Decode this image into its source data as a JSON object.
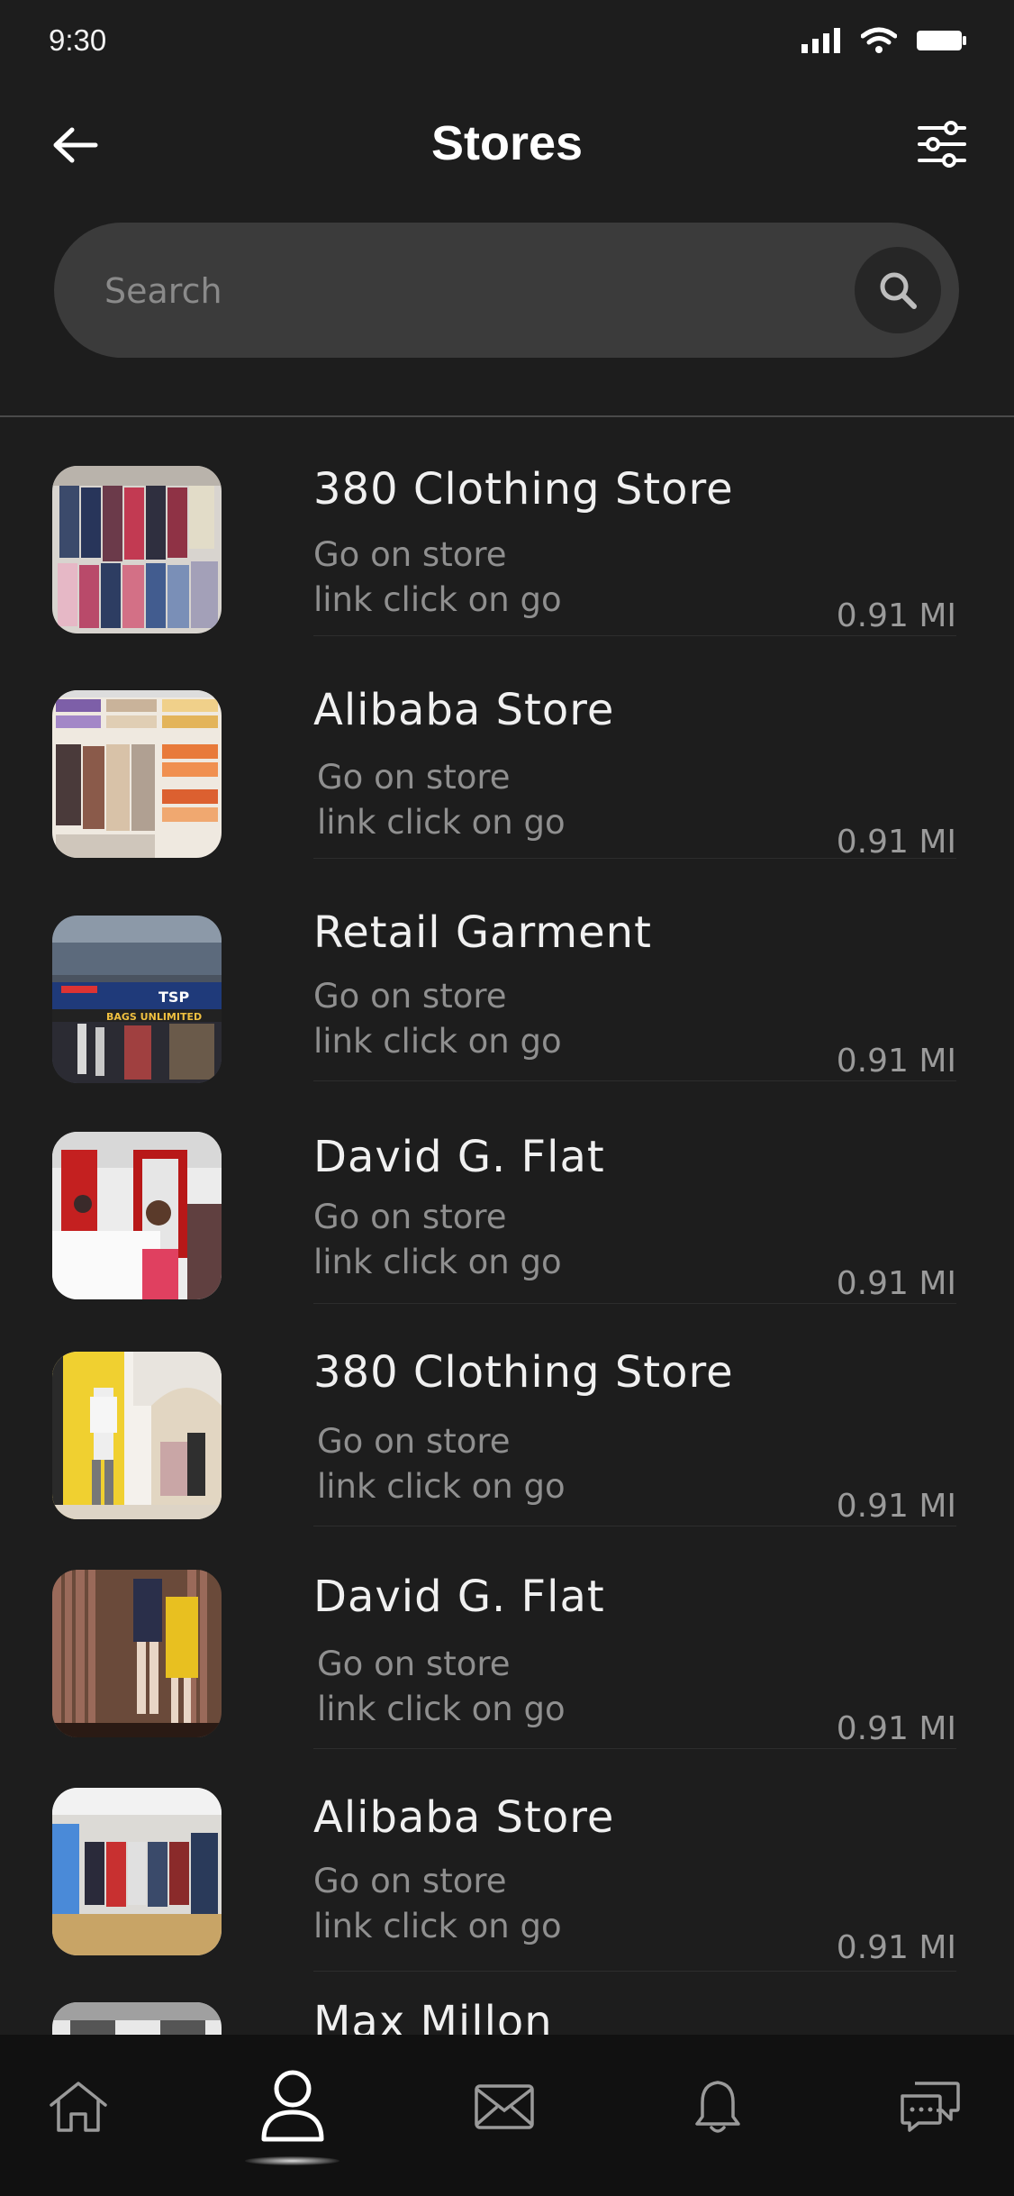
{
  "status_bar": {
    "time": "9:30",
    "icons": [
      "cellular-signal-icon",
      "wifi-icon",
      "battery-icon"
    ]
  },
  "header": {
    "title": "Stores",
    "back_icon": "arrow-left-icon",
    "filter_icon": "sliders-icon"
  },
  "search": {
    "placeholder": "Search",
    "value": "",
    "icon": "search-icon"
  },
  "stores": [
    {
      "name": "380 Clothing Store",
      "desc_line1": "Go on store",
      "desc_line2": "link click on go",
      "distance": "0.91 MI"
    },
    {
      "name": "Alibaba Store",
      "desc_line1": "Go on store",
      "desc_line2": "link click on go",
      "distance": "0.91 MI"
    },
    {
      "name": "Retail Garment",
      "desc_line1": "Go on store",
      "desc_line2": "link click on go",
      "distance": "0.91 MI"
    },
    {
      "name": "David G. Flat",
      "desc_line1": "Go on store",
      "desc_line2": "link click on go",
      "distance": "0.91 MI"
    },
    {
      "name": "380 Clothing Store",
      "desc_line1": "Go on store",
      "desc_line2": "link click on go",
      "distance": "0.91 MI"
    },
    {
      "name": "David G. Flat",
      "desc_line1": "Go on store",
      "desc_line2": "link click on go",
      "distance": "0.91 MI"
    },
    {
      "name": "Alibaba Store",
      "desc_line1": "Go on store",
      "desc_line2": "link click on go",
      "distance": "0.91 MI"
    },
    {
      "name": "Max Millon"
    }
  ],
  "store_thumb_signage": {
    "line1": "TSP",
    "line2": "BAGS UNLIMITED"
  },
  "bottom_nav": {
    "items": [
      "home-icon",
      "profile-icon",
      "mail-icon",
      "bell-icon",
      "chat-icon"
    ],
    "active": "profile-icon"
  },
  "colors": {
    "background": "#1d1d1d",
    "search_bg": "#3b3b3b",
    "nav_bg": "#111111",
    "text_primary": "#f0f0f0",
    "text_secondary": "#8f8f8f"
  }
}
